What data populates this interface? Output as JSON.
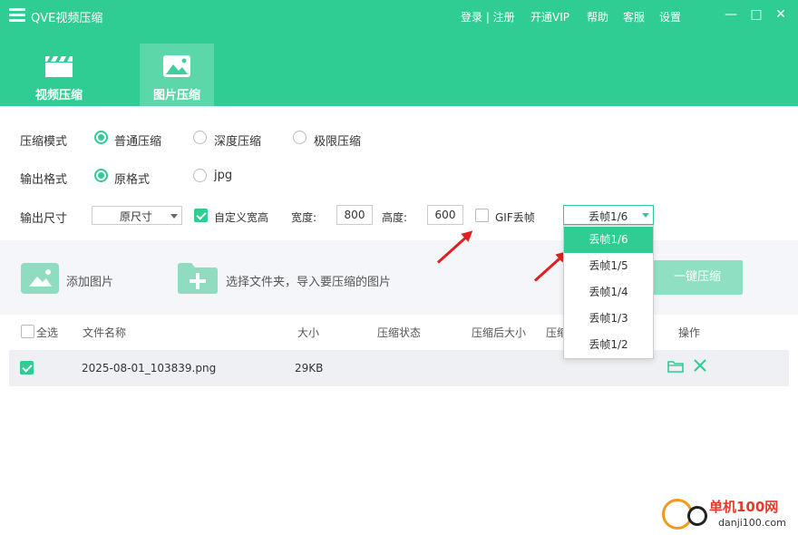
{
  "window": {
    "title": "QVE视频压缩",
    "nav": [
      "登录 | 注册",
      "开通VIP",
      "帮助",
      "客服",
      "设置"
    ],
    "controls": [
      "—",
      "□",
      "✕"
    ]
  },
  "tabs": [
    {
      "label": "视频压缩",
      "icon": "clapperboard-icon"
    },
    {
      "label": "图片压缩",
      "icon": "image-icon",
      "active": true
    }
  ],
  "settings": {
    "mode_label": "压缩模式",
    "modes": [
      "普通压缩",
      "深度压缩",
      "极限压缩"
    ],
    "mode_selected": "普通压缩",
    "format_label": "输出格式",
    "formats": [
      "原格式",
      "jpg"
    ],
    "format_selected": "原格式",
    "size_label": "输出尺寸",
    "size_value": "原尺寸",
    "custom_label": "自定义宽高",
    "custom_checked": true,
    "width_label": "宽度:",
    "width_value": "800",
    "height_label": "高度:",
    "height_value": "600",
    "gif_label": "GIF丢帧",
    "gif_checked": false,
    "gif_value": "丢帧1/6",
    "gif_options": [
      "丢帧1/6",
      "丢帧1/5",
      "丢帧1/4",
      "丢帧1/3",
      "丢帧1/2"
    ],
    "gif_selected": "丢帧1/6"
  },
  "actions": {
    "add_image": "添加图片",
    "select_folder": "选择文件夹，导入要压缩的图片",
    "compress_all": "一键压缩"
  },
  "table": {
    "headers": [
      "全选",
      "文件名称",
      "大小",
      "压缩状态",
      "压缩后大小",
      "压缩",
      "操作"
    ],
    "rows": [
      {
        "checked": true,
        "name": "2025-08-01_103839.png",
        "size": "29KB"
      }
    ]
  },
  "watermark": {
    "text": "单机100网",
    "url": "danji100.com"
  },
  "colors": {
    "accent": "#2fcc93",
    "arrow": "#e02020"
  }
}
